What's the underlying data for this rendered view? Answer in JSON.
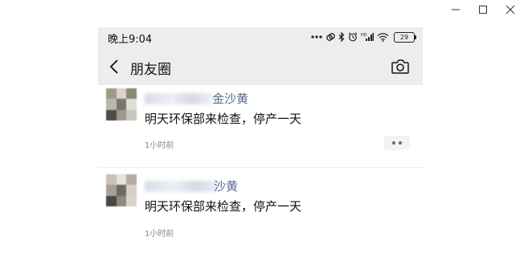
{
  "status_bar": {
    "time": "晚上9:04",
    "battery": "29",
    "icons": [
      "more-dots-icon",
      "link-icon",
      "bluetooth-icon",
      "alarm-icon",
      "hd-signal-icon",
      "wifi-icon",
      "battery-icon"
    ]
  },
  "nav": {
    "title": "朋友圈",
    "back_icon": "chevron-left-icon",
    "camera_icon": "camera-icon"
  },
  "posts": [
    {
      "name": "金沙黄",
      "content": "明天环保部来检查，停产一天",
      "time": "1小时前"
    },
    {
      "name": "沙黄",
      "content": "明天环保部来检查，停产一天",
      "time": "1小时前"
    }
  ],
  "window_controls": [
    "minimize-icon",
    "maximize-icon",
    "close-icon"
  ]
}
